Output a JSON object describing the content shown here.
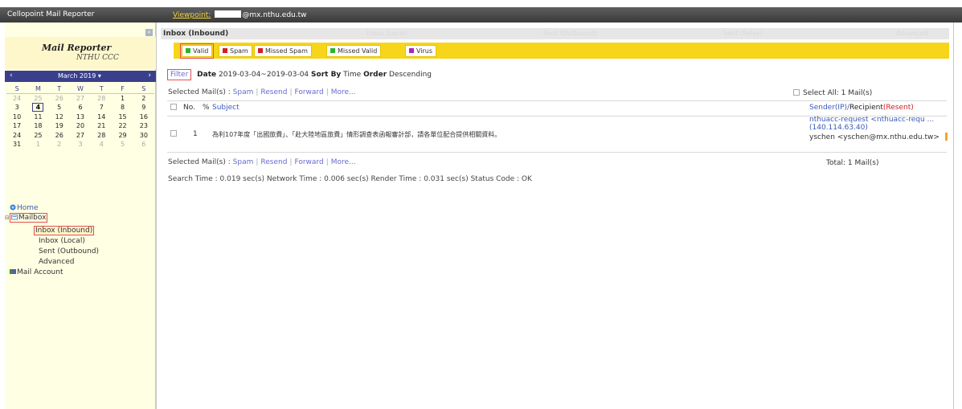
{
  "app": {
    "title": "Cellopoint Mail Reporter",
    "viewpoint_label": "Viewpoint:",
    "viewpoint_value": "@mx.nthu.edu.tw"
  },
  "sidebar": {
    "collapse_icon": "«",
    "brand_title": "Mail Reporter",
    "brand_sub": "NTHU CCC",
    "calendar": {
      "prev": "‹",
      "next": "›",
      "month": "March 2019 ▾",
      "dow": [
        "S",
        "M",
        "T",
        "W",
        "T",
        "F",
        "S"
      ],
      "weeks": [
        [
          "24",
          "25",
          "26",
          "27",
          "28",
          "1",
          "2"
        ],
        [
          "3",
          "4",
          "5",
          "6",
          "7",
          "8",
          "9"
        ],
        [
          "10",
          "11",
          "12",
          "13",
          "14",
          "15",
          "16"
        ],
        [
          "17",
          "18",
          "19",
          "20",
          "21",
          "22",
          "23"
        ],
        [
          "24",
          "25",
          "26",
          "27",
          "28",
          "29",
          "30"
        ],
        [
          "31",
          "1",
          "2",
          "3",
          "4",
          "5",
          "6"
        ]
      ],
      "selected": "4"
    },
    "tree": {
      "home": "Home",
      "mailbox": "Mailbox",
      "inbox_inbound": "Inbox (Inbound)",
      "inbox_local": "Inbox (Local)",
      "sent_outbound": "Sent (Outbound)",
      "advanced": "Advanced",
      "mail_account": "Mail Account"
    }
  },
  "main": {
    "folder_title": "Inbox (Inbound)",
    "ghost_tabs": [
      "Inbox (Local)",
      "Sent (Outbound)",
      "Sent (Relay)",
      "Advanced"
    ],
    "tabs": [
      {
        "label": "Valid",
        "color": "#2bb52b"
      },
      {
        "label": "Spam",
        "color": "#d02020"
      },
      {
        "label": "Missed Spam",
        "color": "#d02020"
      },
      {
        "label": "Missed Valid",
        "color": "#2bb52b"
      },
      {
        "label": "Virus",
        "color": "#b020c0"
      }
    ],
    "filter": {
      "button": "Filter",
      "date_label": "Date",
      "date_value": "2019-03-04~2019-03-04",
      "sort_label": "Sort By",
      "sort_value": "Time",
      "order_label": "Order",
      "order_value": "Descending"
    },
    "actions": {
      "selected": "Selected Mail(s) :",
      "spam": "Spam",
      "resend": "Resend",
      "forward": "Forward",
      "more": "More..."
    },
    "select_all": "Select All: 1 Mail(s)",
    "table": {
      "col_no": "No.",
      "col_attach": "%",
      "col_subject": "Subject",
      "col_sender_a": "Sender(IP)/",
      "col_sender_b": "Recipient",
      "col_sender_c": "(Resent)",
      "rows": [
        {
          "no": "1",
          "subject": "為利107年度「出國旅費」、「赴大陸地區旅費」情形調查表函報審計部，請各單位配合提供相關資料。",
          "sender": "nthuacc-request <nthuacc-requ ...",
          "ip": "(140.114.63.40)",
          "recipient": "yschen <yschen@mx.nthu.edu.tw>"
        }
      ]
    },
    "total": "Total: 1 Mail(s)",
    "timing": "Search Time : 0.019 sec(s)   Network Time : 0.006 sec(s)   Render Time : 0.031 sec(s)   Status Code : OK"
  }
}
